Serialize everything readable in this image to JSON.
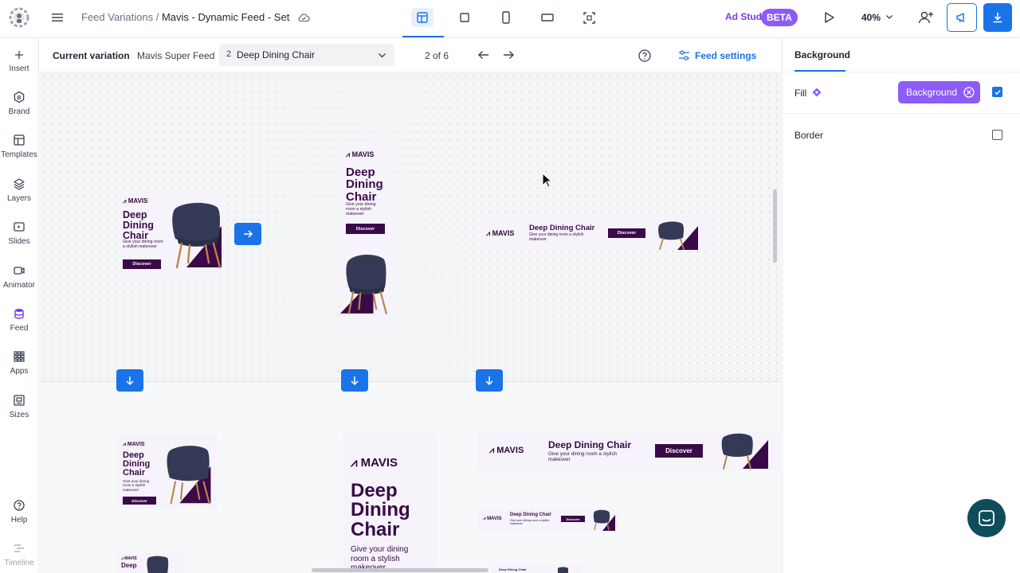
{
  "header": {
    "breadcrumb_parent": "Feed Variations",
    "breadcrumb_sep": " / ",
    "breadcrumb_current": "Mavis - Dynamic Feed - Set",
    "ad_studio": "Ad Studio",
    "beta": "BETA",
    "zoom": "40%"
  },
  "sidebar": {
    "items": [
      {
        "label": "Insert",
        "icon": "plus-icon"
      },
      {
        "label": "Brand",
        "icon": "brand-icon"
      },
      {
        "label": "Templates",
        "icon": "templates-icon"
      },
      {
        "label": "Layers",
        "icon": "layers-icon"
      },
      {
        "label": "Slides",
        "icon": "slides-icon"
      },
      {
        "label": "Animator",
        "icon": "animator-icon"
      },
      {
        "label": "Feed",
        "icon": "database-icon"
      },
      {
        "label": "Apps",
        "icon": "apps-icon"
      },
      {
        "label": "Sizes",
        "icon": "sizes-icon"
      },
      {
        "label": "Help",
        "icon": "help-icon"
      },
      {
        "label": "Timeline",
        "icon": "timeline-icon"
      }
    ]
  },
  "variation_bar": {
    "label": "Current variation",
    "feed_name": "Mavis Super Feed",
    "selected_index": "2",
    "selected_name": "Deep Dining Chair",
    "count": "2 of 6",
    "feed_settings": "Feed settings"
  },
  "ad": {
    "logo": "MAVIS",
    "title": "Deep Dining Chair",
    "title_l1": "Deep",
    "title_l2": "Dining",
    "title_l3": "Chair",
    "subtitle": "Give your dining room a stylish makeover",
    "cta": "Discover"
  },
  "right_panel": {
    "tab": "Background",
    "fill_label": "Fill",
    "fill_chip": "Background",
    "border_label": "Border"
  },
  "colors": {
    "accent": "#1a73e8",
    "ad_dark": "#3a0a48",
    "purple": "#8b5cf6"
  }
}
